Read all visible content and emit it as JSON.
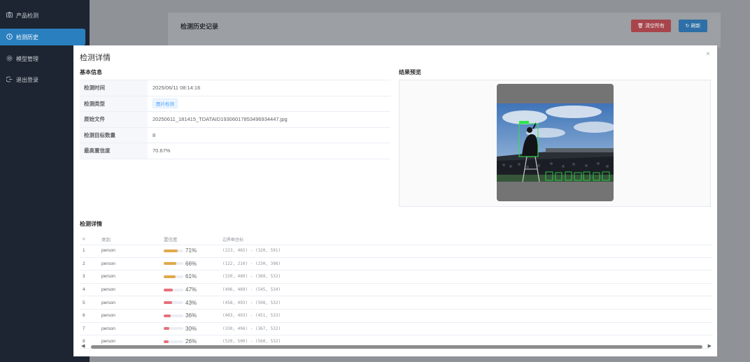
{
  "sidebar": {
    "items": [
      {
        "icon": "camera-icon",
        "label": "产品检测"
      },
      {
        "icon": "clock-icon",
        "label": "检测历史"
      },
      {
        "icon": "gear-icon",
        "label": "模型管理"
      },
      {
        "icon": "logout-icon",
        "label": "退出登录"
      }
    ]
  },
  "background": {
    "card_title": "检测历史记录",
    "clear_button": "清空所有",
    "refresh_button": "刷新"
  },
  "modal": {
    "title": "检测详情",
    "close_symbol": "×",
    "basic_info_title": "基本信息",
    "preview_title": "结果预览",
    "detail_title": "检测详情",
    "info": [
      {
        "label": "检测时间",
        "value": "2025/06/11 08:14:16"
      },
      {
        "label": "检测类型",
        "value": "图片检测"
      },
      {
        "label": "原始文件",
        "value": "20250611_181415_TDATAID19306017853496934447.jpg"
      },
      {
        "label": "检测目标数量",
        "value": "8"
      },
      {
        "label": "最高置信度",
        "value": "70.67%"
      }
    ],
    "table": {
      "headers": [
        "#",
        "类别",
        "置信度",
        "边界框坐标"
      ],
      "rows": [
        {
          "idx": "1",
          "cls": "person",
          "conf": 0.71,
          "conf_label": "71%",
          "box": "(223, 465) - (320, 591)"
        },
        {
          "idx": "2",
          "cls": "person",
          "conf": 0.66,
          "conf_label": "66%",
          "box": "(122, 210) - (230, 398)"
        },
        {
          "idx": "3",
          "cls": "person",
          "conf": 0.61,
          "conf_label": "61%",
          "box": "(320, 480) - (369, 532)"
        },
        {
          "idx": "4",
          "cls": "person",
          "conf": 0.47,
          "conf_label": "47%",
          "box": "(496, 489) - (545, 534)"
        },
        {
          "idx": "5",
          "cls": "person",
          "conf": 0.43,
          "conf_label": "43%",
          "box": "(458, 493) - (508, 532)"
        },
        {
          "idx": "6",
          "cls": "person",
          "conf": 0.36,
          "conf_label": "36%",
          "box": "(403, 493) - (451, 533)"
        },
        {
          "idx": "7",
          "cls": "person",
          "conf": 0.3,
          "conf_label": "30%",
          "box": "(330, 496) - (367, 532)"
        },
        {
          "idx": "8",
          "cls": "person",
          "conf": 0.26,
          "conf_label": "26%",
          "box": "(520, 500) - (560, 532)"
        }
      ]
    }
  },
  "colors": {
    "sidebar_bg": "#1c2531",
    "sidebar_active": "#2a7fbf",
    "bar_high": "#e0a94b",
    "bar_low": "#e6717a",
    "box_green": "#2ee64a"
  }
}
